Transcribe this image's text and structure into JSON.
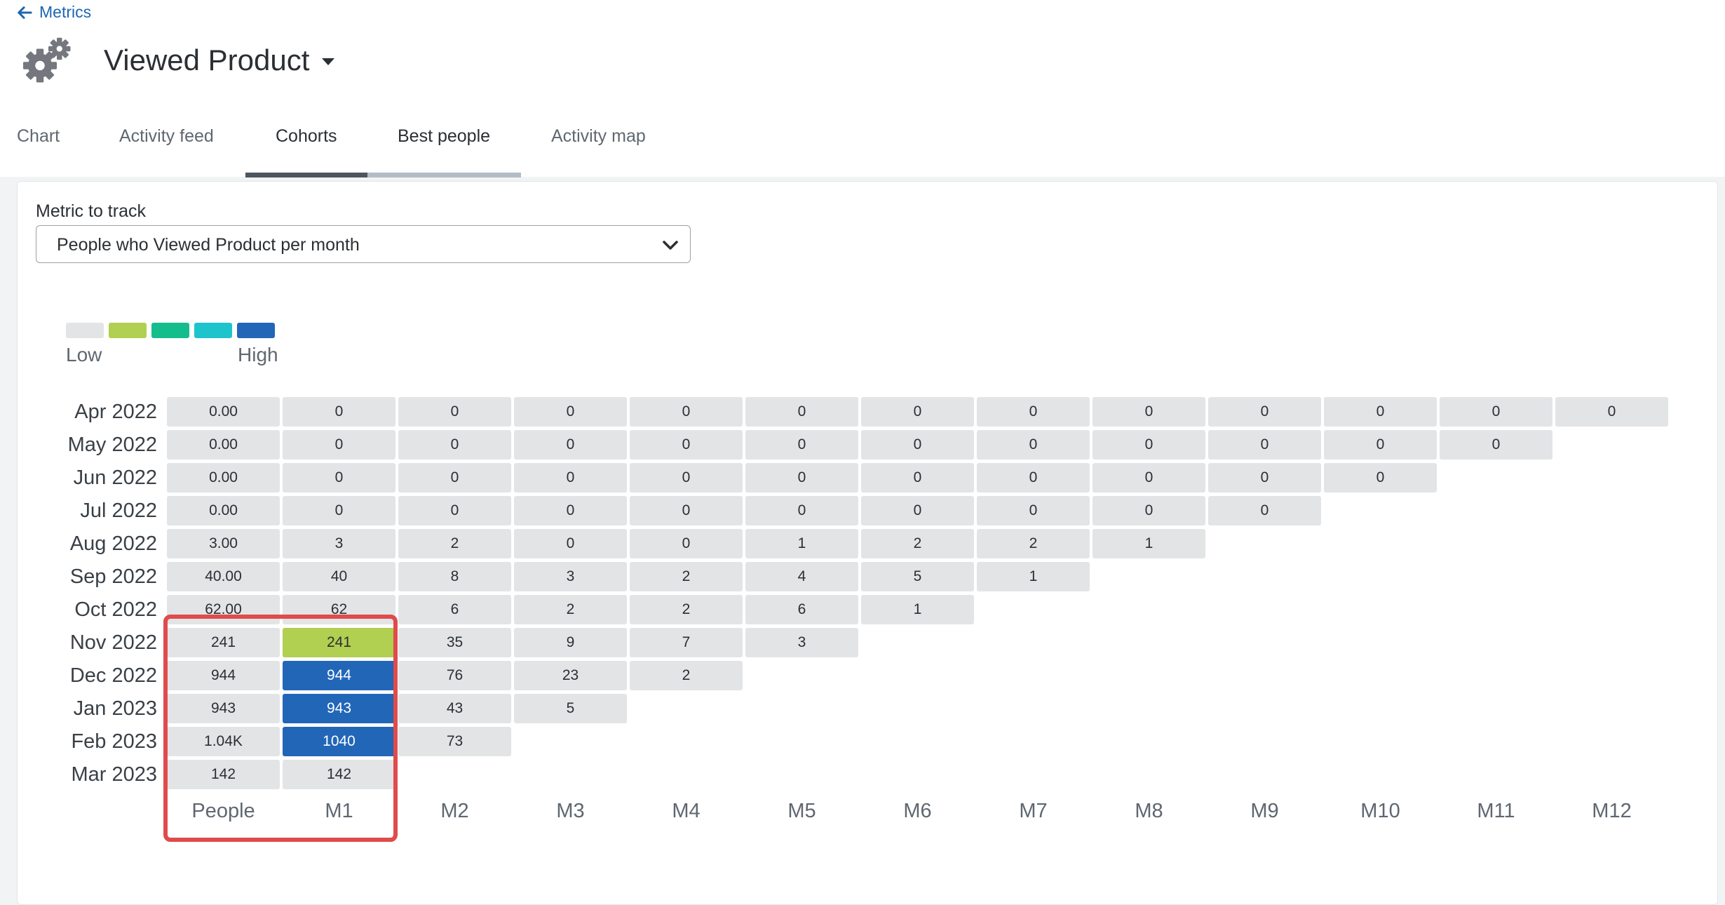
{
  "nav": {
    "back_label": "Metrics"
  },
  "header": {
    "title": "Viewed Product"
  },
  "tabs": [
    {
      "label": "Chart"
    },
    {
      "label": "Activity feed"
    },
    {
      "label": "Cohorts"
    },
    {
      "label": "Best people"
    },
    {
      "label": "Activity map"
    }
  ],
  "metric": {
    "label": "Metric to track",
    "selected": "People who Viewed Product per month"
  },
  "legend": {
    "low_label": "Low",
    "high_label": "High",
    "colors": [
      "#e2e4e6",
      "#b1cf50",
      "#16bd8c",
      "#1ec4cc",
      "#2266b8"
    ]
  },
  "cohort": {
    "columns": [
      "People",
      "M1",
      "M2",
      "M3",
      "M4",
      "M5",
      "M6",
      "M7",
      "M8",
      "M9",
      "M10",
      "M11",
      "M12"
    ],
    "rows": [
      {
        "label": "Apr 2022",
        "people": "0.00",
        "values": [
          "0",
          "0",
          "0",
          "0",
          "0",
          "0",
          "0",
          "0",
          "0",
          "0",
          "0",
          "0"
        ]
      },
      {
        "label": "May 2022",
        "people": "0.00",
        "values": [
          "0",
          "0",
          "0",
          "0",
          "0",
          "0",
          "0",
          "0",
          "0",
          "0",
          "0"
        ]
      },
      {
        "label": "Jun 2022",
        "people": "0.00",
        "values": [
          "0",
          "0",
          "0",
          "0",
          "0",
          "0",
          "0",
          "0",
          "0",
          "0"
        ]
      },
      {
        "label": "Jul 2022",
        "people": "0.00",
        "values": [
          "0",
          "0",
          "0",
          "0",
          "0",
          "0",
          "0",
          "0",
          "0"
        ]
      },
      {
        "label": "Aug 2022",
        "people": "3.00",
        "values": [
          "3",
          "2",
          "0",
          "0",
          "1",
          "2",
          "2",
          "1"
        ]
      },
      {
        "label": "Sep 2022",
        "people": "40.00",
        "values": [
          "40",
          "8",
          "3",
          "2",
          "4",
          "5",
          "1"
        ]
      },
      {
        "label": "Oct 2022",
        "people": "62.00",
        "values": [
          "62",
          "6",
          "2",
          "2",
          "6",
          "1"
        ]
      },
      {
        "label": "Nov 2022",
        "people": "241",
        "values": [
          "241",
          "35",
          "9",
          "7",
          "3"
        ],
        "m1_level": "green"
      },
      {
        "label": "Dec 2022",
        "people": "944",
        "values": [
          "944",
          "76",
          "23",
          "2"
        ],
        "m1_level": "blue"
      },
      {
        "label": "Jan 2023",
        "people": "943",
        "values": [
          "943",
          "43",
          "5"
        ],
        "m1_level": "blue"
      },
      {
        "label": "Feb 2023",
        "people": "1.04K",
        "values": [
          "1040",
          "73"
        ],
        "m1_level": "blue"
      },
      {
        "label": "Mar 2023",
        "people": "142",
        "values": [
          "142"
        ]
      }
    ]
  },
  "colors": {
    "accent": "#1d66b1",
    "highlight": "#e04b4b"
  }
}
